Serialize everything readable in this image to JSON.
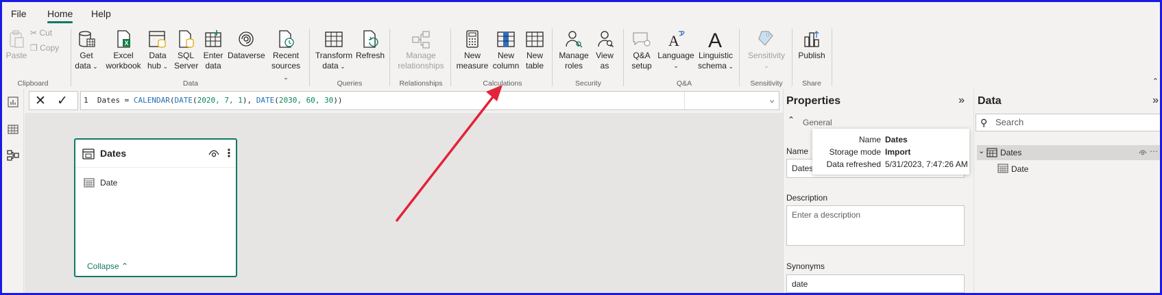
{
  "menu": {
    "file": "File",
    "home": "Home",
    "help": "Help"
  },
  "ribbon": {
    "clipboard": {
      "paste": "Paste",
      "cut": "Cut",
      "copy": "Copy",
      "group": "Clipboard"
    },
    "data": {
      "get_data": [
        "Get",
        "data"
      ],
      "excel": [
        "Excel",
        "workbook"
      ],
      "data_hub": [
        "Data",
        "hub"
      ],
      "sql": [
        "SQL",
        "Server"
      ],
      "enter": [
        "Enter",
        "data"
      ],
      "dataverse": "Dataverse",
      "recent": [
        "Recent",
        "sources"
      ],
      "group": "Data"
    },
    "queries": {
      "transform": [
        "Transform",
        "data"
      ],
      "refresh": "Refresh",
      "group": "Queries"
    },
    "relationships": {
      "manage": [
        "Manage",
        "relationships"
      ],
      "group": "Relationships"
    },
    "calculations": {
      "new_measure": [
        "New",
        "measure"
      ],
      "new_column": [
        "New",
        "column"
      ],
      "new_table": [
        "New",
        "table"
      ],
      "group": "Calculations"
    },
    "security": {
      "manage_roles": [
        "Manage",
        "roles"
      ],
      "view_as": [
        "View",
        "as"
      ],
      "group": "Security"
    },
    "qa": {
      "setup": [
        "Q&A",
        "setup"
      ],
      "language": "Language",
      "linguistic": [
        "Linguistic",
        "schema"
      ],
      "group": "Q&A"
    },
    "sensitivity": {
      "label": "Sensitivity",
      "group": "Sensitivity"
    },
    "share": {
      "publish": "Publish",
      "group": "Share"
    }
  },
  "formula": {
    "line_no": "1",
    "lhs": "Dates = ",
    "fn1": "CALENDAR",
    "fn2": "DATE",
    "args1": "2020, 7, 1",
    "fn3": "DATE",
    "args2": "2030, 60, 30",
    "paren_open": "(",
    "paren_close": ")",
    "sep": ", ",
    "end": "))"
  },
  "table_card": {
    "title": "Dates",
    "field": "Date",
    "collapse": "Collapse"
  },
  "properties": {
    "title": "Properties",
    "general": "General",
    "name_label": "Name",
    "name_value": "Dates",
    "description_label": "Description",
    "description_placeholder": "Enter a description",
    "synonyms_label": "Synonyms",
    "synonyms_value": "date"
  },
  "tooltip": {
    "name_k": "Name",
    "name_v": "Dates",
    "storage_k": "Storage mode",
    "storage_v": "Import",
    "refresh_k": "Data refreshed",
    "refresh_v": "5/31/2023, 7:47:26 AM"
  },
  "data_pane": {
    "title": "Data",
    "search_placeholder": "Search",
    "table": "Dates",
    "field": "Date"
  },
  "colors": {
    "accent": "#117865",
    "arrow": "#e3233a",
    "frame": "#1a1ae6"
  }
}
